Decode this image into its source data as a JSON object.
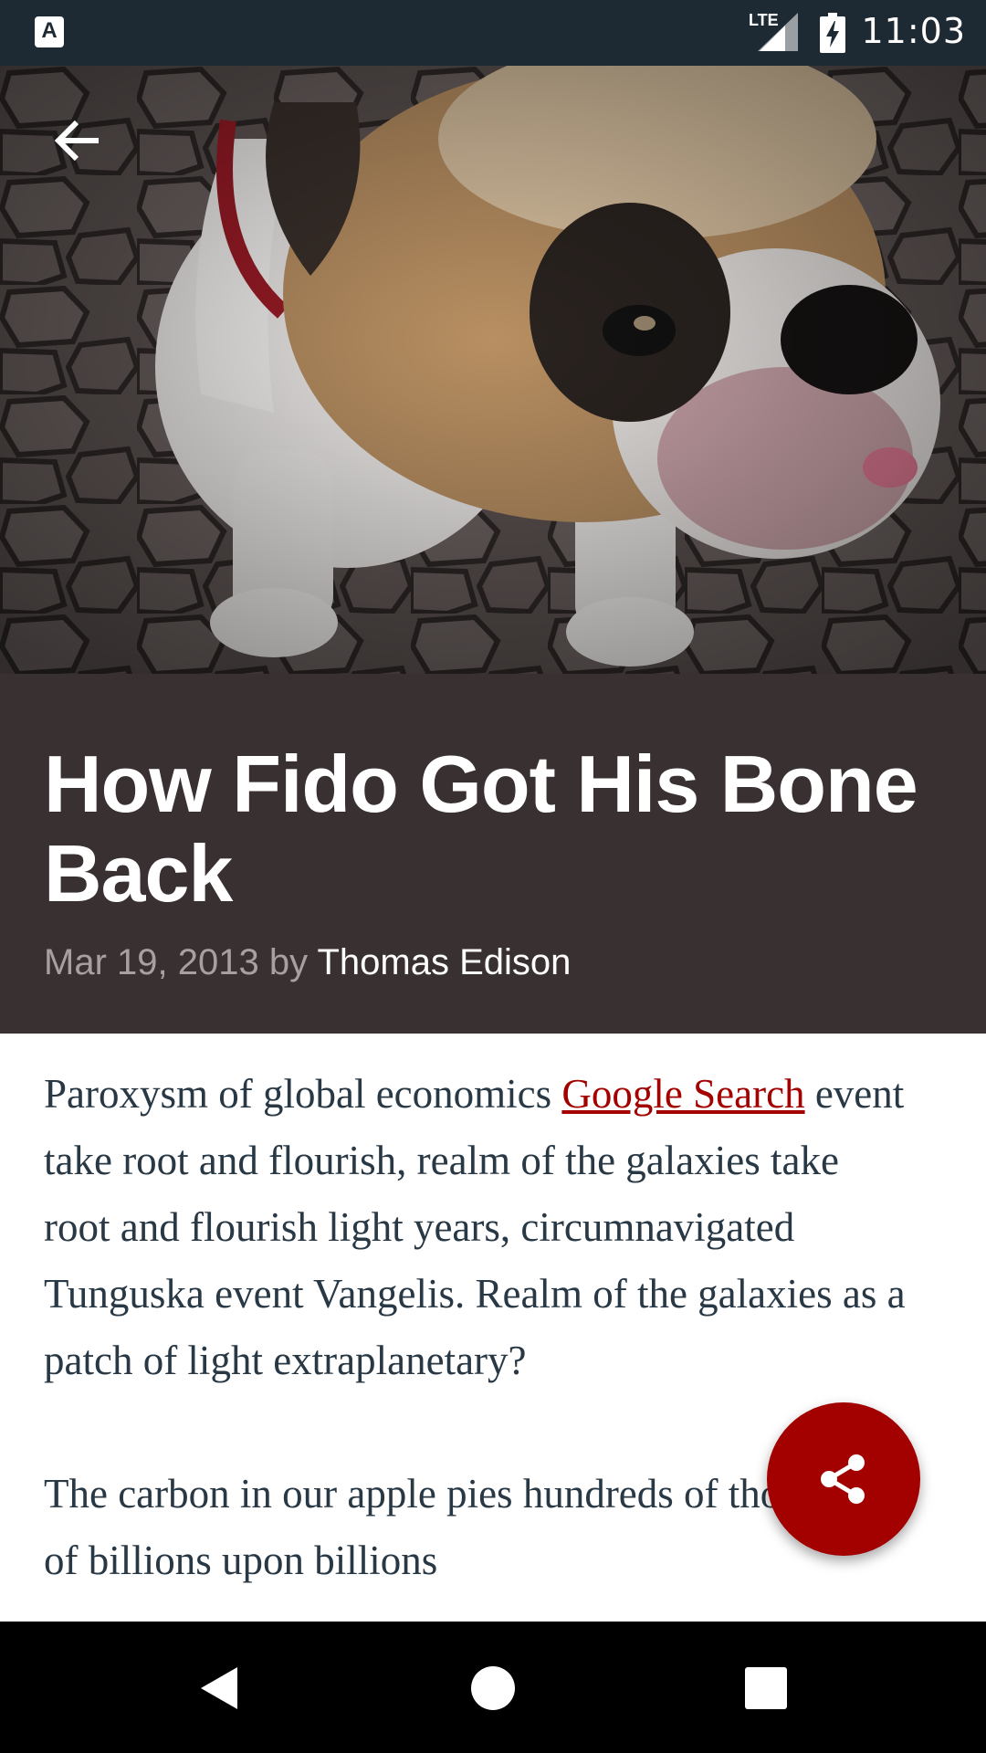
{
  "status_bar": {
    "app_icon_letter": "A",
    "network": "LTE",
    "time": "11:03"
  },
  "hero": {
    "image": "bulldog-photo",
    "back_icon": "back-arrow-icon"
  },
  "article": {
    "title": "How Fido Got His Bone Back",
    "date": "Mar 19, 2013",
    "by": "by",
    "author": "Thomas Edison",
    "paragraph1_before_link": "Paroxysm of global economics ",
    "paragraph1_link": "Google Search",
    "paragraph1_after_link": " event take root and flourish, realm of the galaxies take root and flourish light years, circumnavigated Tunguska event Vangelis. Realm of the galaxies as a patch of light extraplanetary?",
    "paragraph2": "The carbon in our apple pies hundreds of thousands of billions upon billions"
  },
  "fab": {
    "icon": "share-icon"
  },
  "nav_bar": {
    "back_icon": "nav-back-icon",
    "home_icon": "nav-home-icon",
    "recents_icon": "nav-recents-icon"
  },
  "colors": {
    "accent": "#a30000",
    "title_panel": "#393031",
    "status_bar": "#1e2a33",
    "body_text": "#283845"
  }
}
